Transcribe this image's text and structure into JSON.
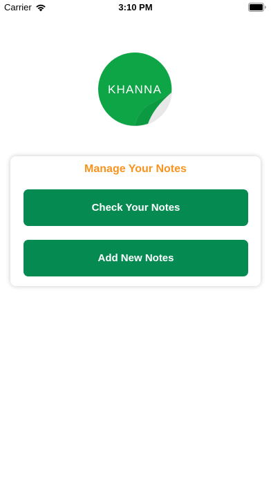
{
  "status_bar": {
    "carrier": "Carrier",
    "time": "3:10 PM",
    "wifi_icon": "wifi-icon",
    "battery_icon": "battery-icon"
  },
  "logo": {
    "text": "KHANNA",
    "circle_color": "#0ea547",
    "curl_color": "#e6e6e6"
  },
  "card": {
    "title": "Manage Your Notes",
    "title_color": "#f7931e",
    "buttons": [
      {
        "label": "Check Your Notes"
      },
      {
        "label": "Add New Notes"
      }
    ],
    "button_color": "#058a52"
  }
}
